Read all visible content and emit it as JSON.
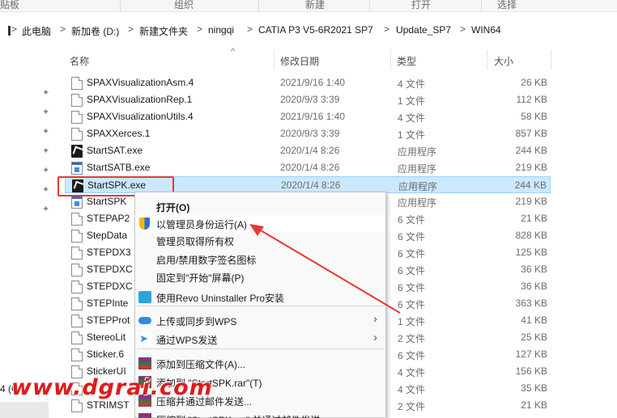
{
  "ribbon": {
    "groups": [
      "贴板",
      "组织",
      "新建",
      "打开",
      "选择"
    ]
  },
  "address_bar": {
    "crumbs": [
      "此电脑",
      "新加卷 (D:)",
      "新建文件夹",
      "ningqi",
      "CATIA P3 V5-6R2021 SP7",
      "Update_SP7",
      "WIN64"
    ],
    "separator": ">"
  },
  "columns": {
    "name": "名称",
    "date": "修改日期",
    "type": "类型",
    "size": "大小",
    "sort_indicator": "^"
  },
  "files": [
    {
      "name": "SPAXVisualizationAsm.4",
      "date": "2021/9/16 1:40",
      "type": "4 文件",
      "size": "26 KB",
      "icon": "doc"
    },
    {
      "name": "SPAXVisualizationRep.1",
      "date": "2020/9/3 3:39",
      "type": "1 文件",
      "size": "112 KB",
      "icon": "doc"
    },
    {
      "name": "SPAXVisualizationUtils.4",
      "date": "2021/9/16 1:40",
      "type": "4 文件",
      "size": "58 KB",
      "icon": "doc"
    },
    {
      "name": "SPAXXerces.1",
      "date": "2020/9/3 3:39",
      "type": "1 文件",
      "size": "857 KB",
      "icon": "doc"
    },
    {
      "name": "StartSAT.exe",
      "date": "2020/1/4 8:26",
      "type": "应用程序",
      "size": "244 KB",
      "icon": "exe-dark"
    },
    {
      "name": "StartSATB.exe",
      "date": "2020/1/4 8:26",
      "type": "应用程序",
      "size": "219 KB",
      "icon": "exe-win"
    },
    {
      "name": "StartSPK.exe",
      "date": "2020/1/4 8:26",
      "type": "应用程序",
      "size": "244 KB",
      "icon": "exe-dark",
      "selected": true
    },
    {
      "name": "StartSPK",
      "date": "",
      "type": "应用程序",
      "size": "219 KB",
      "icon": "exe-win"
    },
    {
      "name": "STEPAP2",
      "date": "",
      "type": "6 文件",
      "size": "21 KB",
      "icon": "doc"
    },
    {
      "name": "StepData",
      "date": "",
      "type": "6 文件",
      "size": "828 KB",
      "icon": "doc"
    },
    {
      "name": "STEPDX3",
      "date": "",
      "type": "6 文件",
      "size": "125 KB",
      "icon": "doc"
    },
    {
      "name": "STEPDXC",
      "date": "",
      "type": "6 文件",
      "size": "36 KB",
      "icon": "doc"
    },
    {
      "name": "STEPDXC",
      "date": "",
      "type": "6 文件",
      "size": "36 KB",
      "icon": "doc"
    },
    {
      "name": "STEPInte",
      "date": "",
      "type": "6 文件",
      "size": "363 KB",
      "icon": "doc"
    },
    {
      "name": "STEPProt",
      "date": "",
      "type": "1 文件",
      "size": "41 KB",
      "icon": "doc"
    },
    {
      "name": "StereoLit",
      "date": "",
      "type": "2 文件",
      "size": "25 KB",
      "icon": "doc"
    },
    {
      "name": "Sticker.6",
      "date": "",
      "type": "6 文件",
      "size": "127 KB",
      "icon": "doc"
    },
    {
      "name": "StickerUI",
      "date": "",
      "type": "4 文件",
      "size": "156 KB",
      "icon": "doc"
    },
    {
      "name": "",
      "date": "",
      "type": "4 文件",
      "size": "35 KB",
      "icon": "doc"
    },
    {
      "name": "STRIMST",
      "date": "",
      "type": "2 文件",
      "size": "21 KB",
      "icon": "doc"
    }
  ],
  "context_menu": {
    "items": [
      {
        "label": "打开(O)",
        "icon": "",
        "bold": true
      },
      {
        "label": "以管理员身份运行(A)",
        "icon": "shield-icon",
        "hover": true
      },
      {
        "label": "管理员取得所有权",
        "icon": ""
      },
      {
        "label": "启用/禁用数字签名图标",
        "icon": ""
      },
      {
        "label": "固定到\"开始\"屏幕(P)",
        "icon": ""
      },
      {
        "label": "使用Revo Uninstaller Pro安装",
        "icon": "revo-icon"
      },
      {
        "label": "上传或同步到WPS",
        "icon": "cloud-icon",
        "submenu": true
      },
      {
        "label": "通过WPS发送",
        "icon": "wps-icon",
        "submenu": true
      },
      {
        "label": "添加到压缩文件(A)...",
        "icon": "rar-icon"
      },
      {
        "label": "添加到 \"StartSPK.rar\"(T)",
        "icon": "rar-icon"
      },
      {
        "label": "压缩并通过邮件发送...",
        "icon": "rar-icon"
      },
      {
        "label": "压缩到 \"StartSPK.rar\" 并通过邮件发送",
        "icon": "rar-icon"
      }
    ],
    "submenu_glyph": "›"
  },
  "nav": {
    "drive_label": "4 (C:)"
  },
  "watermark": "www.dgrai.com",
  "colors": {
    "selection_bg": "#cce8ff",
    "highlight_box": "#e53935",
    "arrow": "#e53935",
    "watermark": "#e01b1b"
  }
}
